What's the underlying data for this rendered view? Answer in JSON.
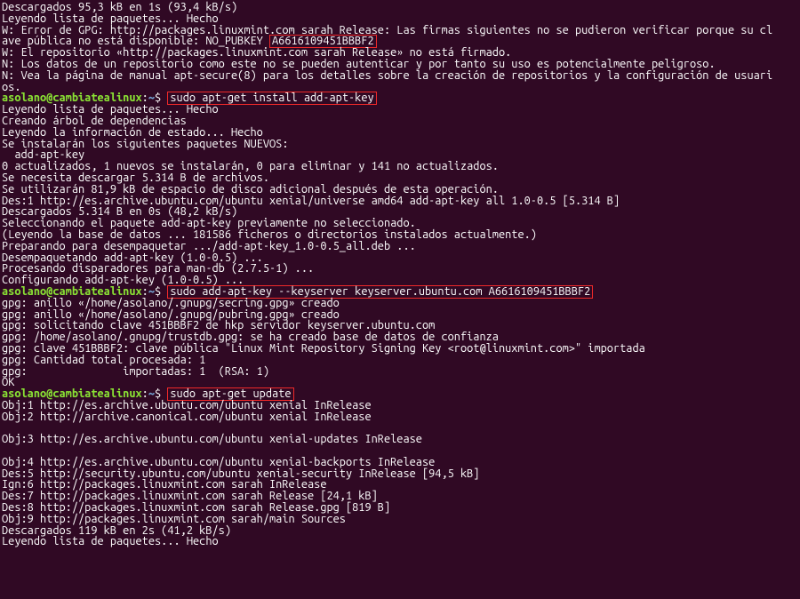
{
  "lines": {
    "l01": "Descargados 95,3 kB en 1s (93,4 kB/s)",
    "l02": "Leyendo lista de paquetes... Hecho",
    "l03a": "W: Error de GPG: http://packages.linuxmint.com sarah Release: Las firmas siguientes no se pudieron verificar porque su cl",
    "l03b": "ave pública no está disponible: NO_PUBKEY ",
    "key1": "A6616109451BBBF2",
    "l04": "W: El repositorio «http://packages.linuxmint.com sarah Release» no está firmado.",
    "l05": "N: Los datos de un repositorio como este no se pueden autenticar y por tanto su uso es potencialmente peligroso.",
    "l06a": "N: Vea la página de manual apt-secure(8) para los detalles sobre la creación de repositorios y la configuración de usuari",
    "l06b": "os.",
    "prompt_user": "asolano@cambiatealinux",
    "prompt_col": ":",
    "prompt_path": "~",
    "prompt_dollar": "$ ",
    "cmd1": "sudo apt-get install add-apt-key",
    "l08": "Leyendo lista de paquetes... Hecho",
    "l09": "Creando árbol de dependencias",
    "l10": "Leyendo la información de estado... Hecho",
    "l11": "Se instalarán los siguientes paquetes NUEVOS:",
    "l12": "  add-apt-key",
    "l13": "0 actualizados, 1 nuevos se instalarán, 0 para eliminar y 141 no actualizados.",
    "l14": "Se necesita descargar 5.314 B de archivos.",
    "l15": "Se utilizarán 81,9 kB de espacio de disco adicional después de esta operación.",
    "l16": "Des:1 http://es.archive.ubuntu.com/ubuntu xenial/universe amd64 add-apt-key all 1.0-0.5 [5.314 B]",
    "l17": "Descargados 5.314 B en 0s (48,2 kB/s)",
    "l18": "Seleccionando el paquete add-apt-key previamente no seleccionado.",
    "l19": "(Leyendo la base de datos ... 181586 ficheros o directorios instalados actualmente.)",
    "l20": "Preparando para desempaquetar .../add-apt-key_1.0-0.5_all.deb ...",
    "l21": "Desempaquetando add-apt-key (1.0-0.5) ...",
    "l22": "Procesando disparadores para man-db (2.7.5-1) ...",
    "l23": "Configurando add-apt-key (1.0-0.5) ...",
    "cmd2": "sudo add-apt-key --keyserver keyserver.ubuntu.com A6616109451BBBF2",
    "l25": "gpg: anillo «/home/asolano/.gnupg/secring.gpg» creado",
    "l26": "gpg: anillo «/home/asolano/.gnupg/pubring.gpg» creado",
    "l27": "gpg: solicitando clave 451BBBF2 de hkp servidor keyserver.ubuntu.com",
    "l28": "gpg: /home/asolano/.gnupg/trustdb.gpg: se ha creado base de datos de confianza",
    "l29": "gpg: clave 451BBBF2: clave pública \"Linux Mint Repository Signing Key <root@linuxmint.com>\" importada",
    "l30": "gpg: Cantidad total procesada: 1",
    "l31": "gpg:               importadas: 1  (RSA: 1)",
    "l32": "OK",
    "cmd3": "sudo apt-get update",
    "l34": "Obj:1 http://es.archive.ubuntu.com/ubuntu xenial InRelease",
    "l35": "Obj:2 http://archive.canonical.com/ubuntu xenial InRelease",
    "blank": "",
    "l36": "Obj:3 http://es.archive.ubuntu.com/ubuntu xenial-updates InRelease",
    "l37": "Obj:4 http://es.archive.ubuntu.com/ubuntu xenial-backports InRelease",
    "l38": "Des:5 http://security.ubuntu.com/ubuntu xenial-security InRelease [94,5 kB]",
    "l39": "Ign:6 http://packages.linuxmint.com sarah InRelease",
    "l40": "Des:7 http://packages.linuxmint.com sarah Release [24,1 kB]",
    "l41": "Des:8 http://packages.linuxmint.com sarah Release.gpg [819 B]",
    "l42": "Obj:9 http://packages.linuxmint.com sarah/main Sources",
    "l43": "Descargados 119 kB en 2s (41,2 kB/s)",
    "l44": "Leyendo lista de paquetes... Hecho"
  }
}
